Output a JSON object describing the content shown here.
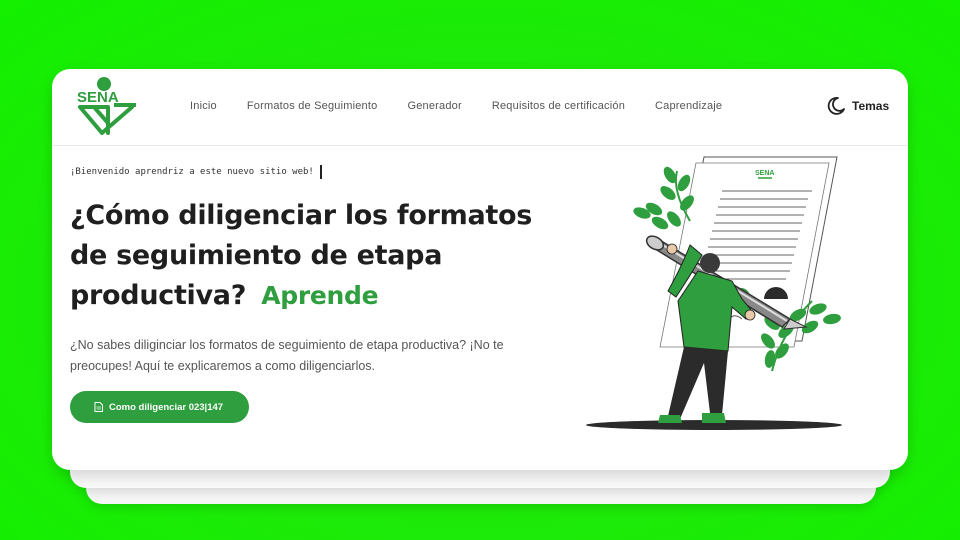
{
  "brand": {
    "logo_text": "SENA",
    "color": "#2e9e3e"
  },
  "nav": {
    "items": [
      {
        "label": "Inicio"
      },
      {
        "label": "Formatos de Seguimiento"
      },
      {
        "label": "Generador"
      },
      {
        "label": "Requisitos de certificación"
      },
      {
        "label": "Caprendizaje"
      }
    ],
    "themes_label": "Temas",
    "themes_icon": "moon-icon"
  },
  "hero": {
    "welcome": "¡Bienvenido aprendriz a este nuevo sitio web!",
    "headline": "¿Cómo diligenciar los formatos de seguimiento de etapa productiva?",
    "headline_accent": "Aprende",
    "description": "¿No sabes diliginciar los formatos de seguimiento de etapa productiva? ¡No te preocupes! Aquí te explicaremos a como diligenciarlos.",
    "cta_label": "Como diligenciar 023|147",
    "cta_icon": "document-icon"
  },
  "illustration": {
    "document_logo_text": "SENA"
  },
  "colors": {
    "background": "#1fe80a",
    "accent": "#2e9e3e",
    "text": "#1f1f1f"
  }
}
